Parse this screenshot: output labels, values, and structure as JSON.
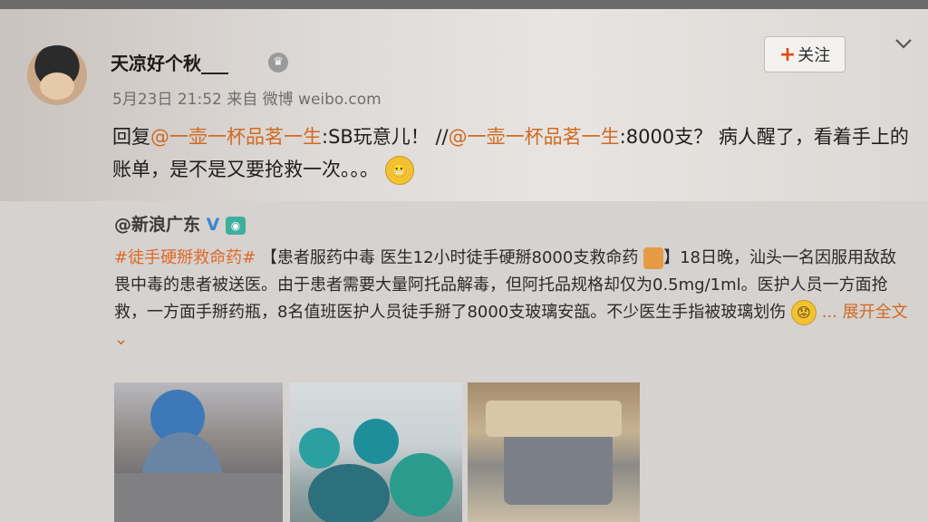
{
  "post": {
    "username": "天凉好个秋___",
    "meta": "5月23日 21:52 来自 微博 weibo.com",
    "follow_label": "关注",
    "reply_prefix": "回复",
    "mention_1": "@一壶一杯品茗一生",
    "reply_body_1": ":SB玩意儿！ //",
    "mention_2": "@一壶一杯品茗一生",
    "reply_body_2": ":8000支？ 病人醒了，看着手上的账单，是不是又要抢救一次。。。",
    "emoji_label": "😬"
  },
  "repost": {
    "user": "@新浪广东",
    "topic": "#徒手硬掰救命药#",
    "text": "【患者服药中毒 医生12小时徒手硬掰8000支救命药",
    "text_rest": "】18日晚，汕头一名因服用敌敌畏中毒的患者被送医。由于患者需要大量阿托品解毒，但阿托品规格却仅为0.5mg/1ml。医护人员一方面抢救，一方面手掰药瓶，8名值班医护人员徒手掰了8000支玻璃安瓿。不少医生手指被玻璃划伤",
    "more_label": "... 展开全文",
    "chev_label": "⌄"
  },
  "colors": {
    "mention": "#d06a22",
    "topic": "#e06a2a",
    "verified": "#3b86c6"
  }
}
